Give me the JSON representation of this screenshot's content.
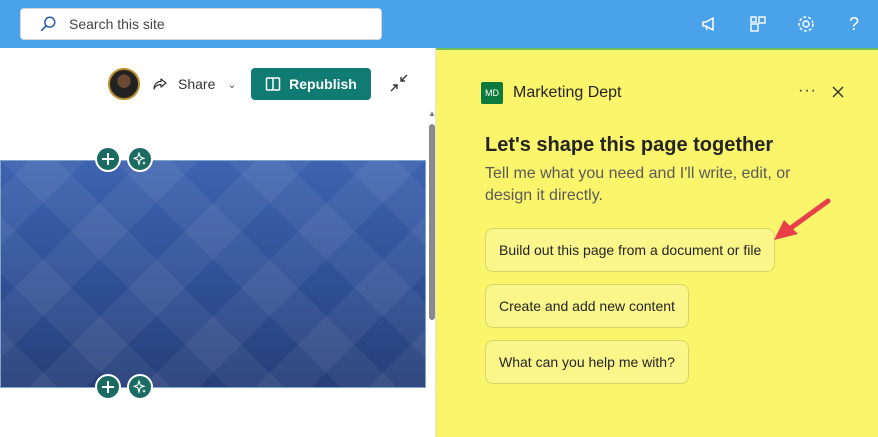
{
  "search": {
    "placeholder": "Search this site"
  },
  "topbar_icons": [
    "megaphone-icon",
    "apps-switcher-icon",
    "gear-icon",
    "help-icon"
  ],
  "help_glyph": "?",
  "toolbar": {
    "share_label": "Share",
    "republish_label": "Republish"
  },
  "panel": {
    "logo_text": "MD",
    "site_name": "Marketing Dept",
    "more_label": "···",
    "heading": "Let's shape this page together",
    "subtext": "Tell me what you need and I'll write, edit, or design it directly.",
    "suggestions": [
      "Build out this page from a document or file",
      "Create and add new content",
      "What can you help me with?"
    ]
  },
  "colors": {
    "topbar": "#4aa2ea",
    "panel_bg": "#faf56a",
    "republish_bg": "#0f7b73",
    "annotation_arrow": "#e8404a"
  }
}
